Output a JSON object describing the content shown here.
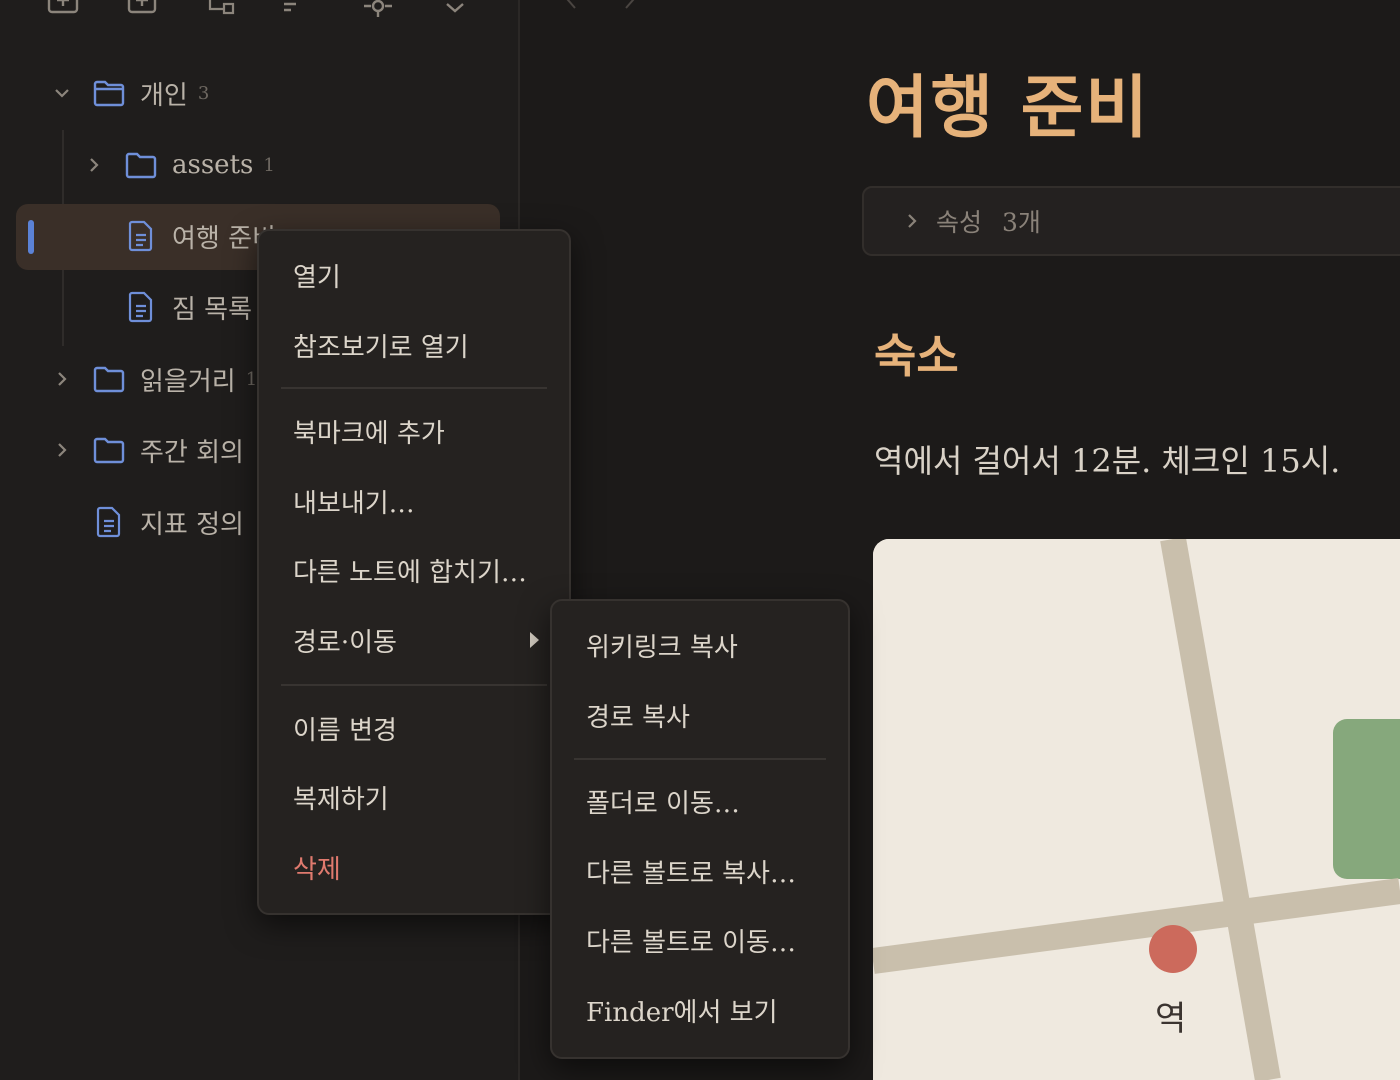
{
  "sidebar": {
    "toolbar": {
      "icons": [
        "new-note-icon",
        "new-folder-icon",
        "hierarchy-icon",
        "sort-icon",
        "collapse-icon",
        "chevron-down-icon"
      ]
    },
    "tree": {
      "folder_personal": {
        "label": "개인",
        "count": "3"
      },
      "folder_assets": {
        "label": "assets",
        "count": "1"
      },
      "note_trip": {
        "label": "여행 준비"
      },
      "note_packing": {
        "label": "짐 목록"
      },
      "folder_reading": {
        "label": "읽을거리",
        "count": "1"
      },
      "folder_weekly": {
        "label": "주간 회의"
      },
      "note_metrics": {
        "label": "지표 정의"
      }
    }
  },
  "note": {
    "title": "여행 준비",
    "properties": {
      "label": "속성",
      "count": "3개"
    },
    "heading": "숙소",
    "paragraph": "역에서 걸어서 12분. 체크인 15시.",
    "map": {
      "station_label": "역"
    }
  },
  "context_menu": {
    "open": "열기",
    "open_reference": "참조보기로 열기",
    "add_bookmark": "북마크에 추가",
    "export": "내보내기…",
    "merge": "다른 노트에 합치기…",
    "path_move": "경로·이동",
    "rename": "이름 변경",
    "duplicate": "복제하기",
    "delete": "삭제"
  },
  "submenu": {
    "copy_wikilink": "위키링크 복사",
    "copy_path": "경로 복사",
    "move_folder": "폴더로 이동…",
    "copy_vault": "다른 볼트로 복사…",
    "move_vault": "다른 볼트로 이동…",
    "show_finder": "Finder에서 보기"
  },
  "colors": {
    "accent_heading": "#e6b27a",
    "active_indicator": "#5b82d6",
    "danger": "#e07a6e",
    "folder_icon": "#6f8fd9",
    "map_pin": "#cc6a5c",
    "map_park": "#86a87c"
  }
}
